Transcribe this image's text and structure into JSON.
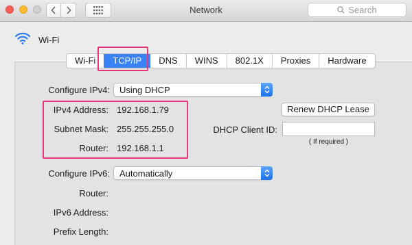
{
  "window": {
    "title": "Network"
  },
  "search": {
    "placeholder": "Search"
  },
  "service": {
    "name": "Wi-Fi"
  },
  "tabs": [
    {
      "label": "Wi-Fi",
      "active": false
    },
    {
      "label": "TCP/IP",
      "active": true
    },
    {
      "label": "DNS",
      "active": false
    },
    {
      "label": "WINS",
      "active": false
    },
    {
      "label": "802.1X",
      "active": false
    },
    {
      "label": "Proxies",
      "active": false
    },
    {
      "label": "Hardware",
      "active": false
    }
  ],
  "ipv4": {
    "configure_label": "Configure IPv4:",
    "configure_value": "Using DHCP",
    "address_label": "IPv4 Address:",
    "address_value": "192.168.1.79",
    "subnet_label": "Subnet Mask:",
    "subnet_value": "255.255.255.0",
    "router_label": "Router:",
    "router_value": "192.168.1.1"
  },
  "dhcp": {
    "renew_label": "Renew DHCP Lease",
    "client_id_label": "DHCP Client ID:",
    "client_id_value": "",
    "hint": "( If required )"
  },
  "ipv6": {
    "configure_label": "Configure IPv6:",
    "configure_value": "Automatically",
    "router_label": "Router:",
    "address_label": "IPv6 Address:",
    "prefix_label": "Prefix Length:"
  },
  "colors": {
    "accent": "#3a83f6",
    "highlight": "#e8357a"
  },
  "icons": {
    "back": "chevron-left-icon",
    "forward": "chevron-right-icon",
    "grid": "grid-icon",
    "search": "search-icon",
    "wifi": "wifi-icon",
    "popup": "up-down-arrows-icon"
  }
}
